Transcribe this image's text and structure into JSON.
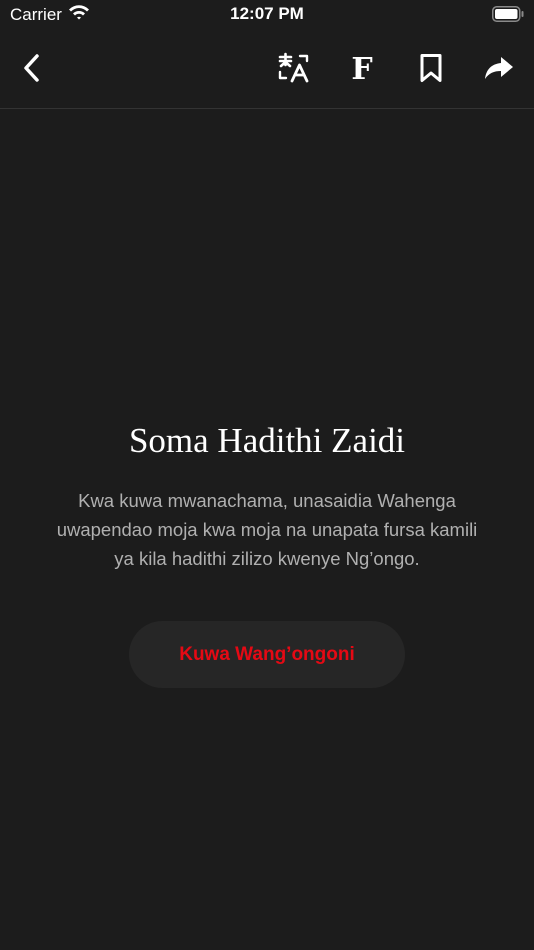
{
  "status_bar": {
    "carrier": "Carrier",
    "time": "12:07 PM",
    "icons": [
      "wifi-icon",
      "battery-icon"
    ]
  },
  "nav": {
    "icons": [
      "chevron-left-icon",
      "translate-icon",
      "font-icon",
      "bookmark-icon",
      "share-icon"
    ],
    "font_glyph": "F"
  },
  "content": {
    "title": "Soma Hadithi Zaidi",
    "body": "Kwa kuwa mwanachama, unasaidia Wahenga uwapendao moja kwa moja na unapata fursa kamili ya kila hadithi zilizo kwenye Ng’ongo.",
    "cta_label": "Kuwa Wang’ongoni"
  },
  "colors": {
    "background": "#1c1c1c",
    "accent": "#e50914",
    "button_bg": "#262626",
    "body_text": "#b0b0b0",
    "divider": "#333333"
  }
}
